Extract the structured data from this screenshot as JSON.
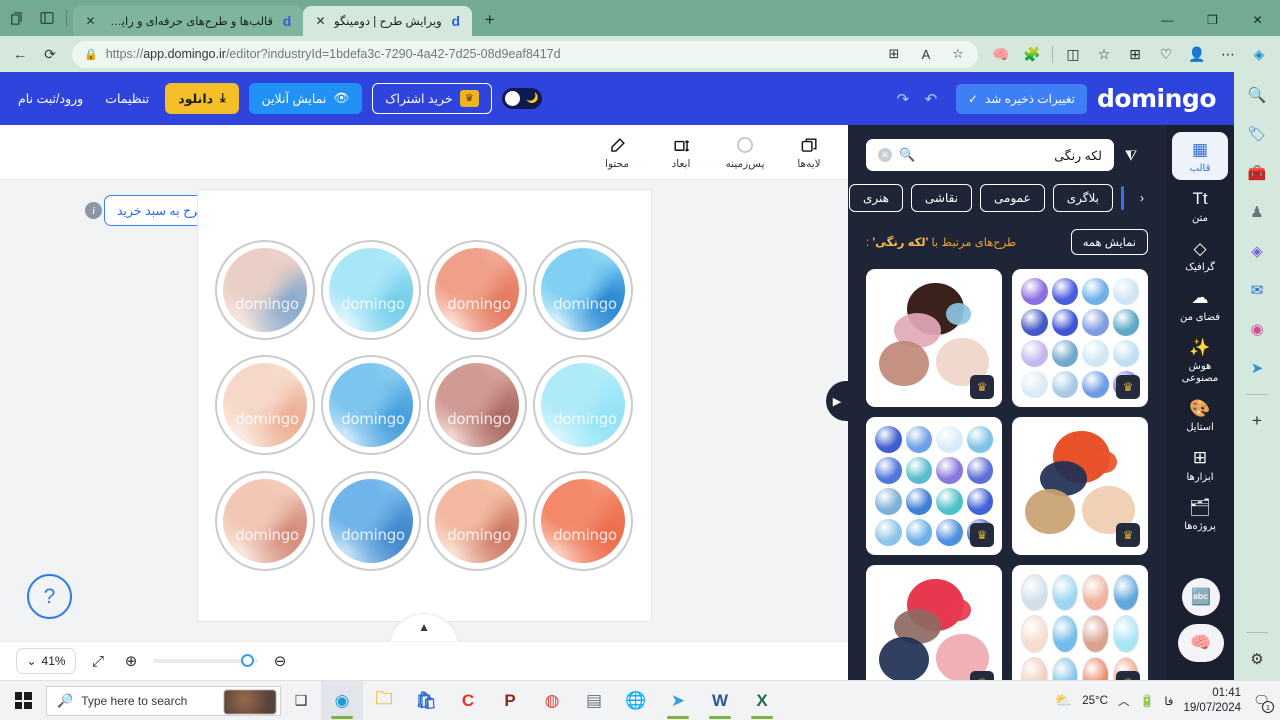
{
  "browser": {
    "tabs": [
      {
        "title": "قالب‌ها و طرح‌های حرفه‌ای و رایگان",
        "favicon": "d",
        "active": false
      },
      {
        "title": "ویرایش طرح | دومینگو",
        "favicon": "d",
        "active": true
      }
    ],
    "newtab_label": "+",
    "url_prefix": "https://",
    "url_main": "app.domingo.ir",
    "url_rest": "/editor?industryId=1bdefa3c-7290-4a42-7d25-08d9eaf8417d",
    "window_controls": {
      "minimize": "—",
      "maximize": "❐",
      "close": "✕"
    },
    "nav": {
      "back": "←",
      "reload": "⟳"
    },
    "toolbar_icons": [
      "copilot-brain-icon",
      "extensions-icon",
      "split-screen-icon",
      "favorites-icon",
      "collections-icon",
      "browser-essentials-icon",
      "profile-avatar",
      "more-options-icon",
      "copilot-icon"
    ]
  },
  "edge_sidebar": {
    "items": [
      {
        "name": "search-icon",
        "glyph": "🔍"
      },
      {
        "name": "shopping-tag-icon",
        "glyph": "🏷"
      },
      {
        "name": "tools-briefcase-icon",
        "glyph": "🧰"
      },
      {
        "name": "games-icon",
        "glyph": "♟"
      },
      {
        "name": "microsoft-365-icon",
        "glyph": "◈"
      },
      {
        "name": "outlook-icon",
        "glyph": "✉"
      },
      {
        "name": "designer-icon",
        "glyph": "◉"
      },
      {
        "name": "telegram-icon",
        "glyph": "➤"
      },
      {
        "name": "add-sidebar-app-icon",
        "glyph": "+"
      },
      {
        "name": "sidebar-settings-icon",
        "glyph": "⚙"
      }
    ]
  },
  "app_header": {
    "logo": "domingo",
    "saved_label": "تغییرات ذخیره شد",
    "saved_check": "✓",
    "undo": "↶",
    "redo": "↷",
    "dark_mode_label": "dark-mode-toggle",
    "subscription_label": "خرید اشتراک",
    "subscription_crown": "♛",
    "preview_label": "نمایش آنلاین",
    "preview_icon": "👁",
    "download_label": "دانلود",
    "download_icon": "⤓",
    "settings_label": "تنظیمات",
    "login_label": "ورود/ثبت نام"
  },
  "editor_toolbar": {
    "items": [
      {
        "label": "لایه‌ها",
        "icon": "layers-icon",
        "glyph": "❐"
      },
      {
        "label": "پس‌زمینه",
        "icon": "background-circle-icon",
        "glyph": "◯"
      },
      {
        "label": "ابعاد",
        "icon": "dimensions-icon",
        "glyph": "⤢"
      },
      {
        "label": "محتوا",
        "icon": "content-pencil-icon",
        "glyph": "✎"
      }
    ]
  },
  "canvas": {
    "add_to_cart_label": "افزودن طرح به سبد خرید",
    "cart_icon": "🛍",
    "info_icon": "i",
    "help_icon": "?",
    "bottom_handle_icon": "▲",
    "watermark": "domingo",
    "artwork_title": "grid-of-ink-circles",
    "blobs": [
      {
        "c1": "#7fd0f3",
        "c2": "#1f7fd0",
        "c3": "#d9f2fc"
      },
      {
        "c1": "#f0a089",
        "c2": "#e3745a",
        "c3": "#fae3da"
      },
      {
        "c1": "#a8e6f8",
        "c2": "#6fcbe8",
        "c3": "#e6f8fd"
      },
      {
        "c1": "#e9cfc6",
        "c2": "#7ba6cf",
        "c3": "#f7eae4"
      },
      {
        "c1": "#aeeaf8",
        "c2": "#8fe2f6",
        "c3": "#ddf7fd"
      },
      {
        "c1": "#d19a94",
        "c2": "#a5635d",
        "c3": "#f3ded6"
      },
      {
        "c1": "#7cc5ef",
        "c2": "#3f9ada",
        "c3": "#d5ecfa"
      },
      {
        "c1": "#f6d8c8",
        "c2": "#eca98f",
        "c3": "#fbeee6"
      },
      {
        "c1": "#f4886a",
        "c2": "#ec6a49",
        "c3": "#fbd8cb"
      },
      {
        "c1": "#f3b9a0",
        "c2": "#c9705a",
        "c3": "#fae6db"
      },
      {
        "c1": "#6fb4ea",
        "c2": "#3b82c9",
        "c3": "#cfe6f7"
      },
      {
        "c1": "#f2c7b6",
        "c2": "#cf8574",
        "c3": "#fbeae2"
      }
    ]
  },
  "zoom_bar": {
    "level": "41%",
    "chevron": "⌄",
    "fit_icon": "⤢",
    "zoom_in_icon": "⊕",
    "zoom_out_icon": "⊖"
  },
  "panel": {
    "collapse_icon": "▶",
    "filter_icon": "⧩",
    "search_icon": "🔍",
    "search_value": "لکه رنگی",
    "search_clear": "✕",
    "chips": [
      "هنری",
      "نقاشی",
      "عمومی",
      "بلاگری"
    ],
    "chips_prev_arrow": "‹",
    "related_title_prefix": "طرح‌های مرتبط با",
    "related_query": "'لکه رنگی'",
    "related_title_suffix": ":",
    "show_all_label": "نمایش همه",
    "crown_icon": "♛",
    "thumbnails": [
      {
        "name": "blue-purple-swatch-grid",
        "type": "grid",
        "colors": [
          "#cfe4f5",
          "#6fb0e8",
          "#4a5ddc",
          "#8b6fe0",
          "#5fa9c8",
          "#7f9de0",
          "#3f55d6",
          "#4658c6",
          "#bfe0f3",
          "#cfe8f4",
          "#6fa8cd",
          "#c3b9ef",
          "#8470e8",
          "#6f9ce6",
          "#a8c9e4",
          "#dcebf6"
        ]
      },
      {
        "name": "brown-pink-ink-cluster",
        "type": "cluster",
        "colors": [
          "#3b211c",
          "#e3a9b8",
          "#c08877",
          "#efd6c8",
          "#8ec4e0"
        ]
      },
      {
        "name": "orange-navy-ink-cluster",
        "type": "cluster",
        "colors": [
          "#e8522a",
          "#1f2f52",
          "#c9a172",
          "#f0cdb0",
          "#e8522a"
        ]
      },
      {
        "name": "blue-watercolor-swatch-grid",
        "type": "grid",
        "colors": [
          "#7fc4e8",
          "#d8ecf7",
          "#6fa0e8",
          "#3f5fd0",
          "#5f6fd8",
          "#8878e0",
          "#59bccc",
          "#4f78dd",
          "#3f62d6",
          "#4fc0c8",
          "#3f7fd8",
          "#7fb0d8",
          "#3f5fd8",
          "#4f8fe0",
          "#6fb0e8",
          "#8fc4ea"
        ]
      },
      {
        "name": "ink-circles-swatch-grid",
        "type": "gridr",
        "colors": [
          "#5fa8de",
          "#f0b49e",
          "#9fd6ef",
          "#cfe0ea",
          "#a8e6f6",
          "#dba291",
          "#6fbde8",
          "#f6ddcd",
          "#f3a183",
          "#ea8a6d",
          "#7fc2e8",
          "#f2cdbc"
        ]
      },
      {
        "name": "red-pink-ink-cluster",
        "type": "cluster",
        "colors": [
          "#e8384f",
          "#8d6a62",
          "#1f2f52",
          "#f0a8b0",
          "#e8384f"
        ]
      }
    ]
  },
  "app_rail": {
    "items": [
      {
        "label": "قالب",
        "icon": "template-grid-icon",
        "glyph": "▦",
        "active": true
      },
      {
        "label": "متن",
        "icon": "text-icon",
        "glyph": "Tt",
        "active": false
      },
      {
        "label": "گرافیک",
        "icon": "graphics-shapes-icon",
        "glyph": "◇",
        "active": false
      },
      {
        "label": "فضای من",
        "icon": "upload-cloud-icon",
        "glyph": "☁",
        "active": false
      },
      {
        "label": "هوش مصنوعی",
        "icon": "ai-wand-icon",
        "glyph": "✨",
        "active": false
      },
      {
        "label": "استایل",
        "icon": "palette-icon",
        "glyph": "🎨",
        "active": false
      },
      {
        "label": "ابزارها",
        "icon": "tools-grid-icon",
        "glyph": "⊞",
        "active": false
      },
      {
        "label": "پروژه‌ها",
        "icon": "projects-icon",
        "glyph": "🗂",
        "active": false
      }
    ],
    "floating_translate_icon": "🔤",
    "floating_ai_icon": "🧠"
  },
  "taskbar": {
    "search_placeholder": "Type here to search",
    "search_icon": "🔎",
    "task_view_icon": "❑",
    "apps": [
      {
        "name": "edge-icon",
        "glyph": "◉",
        "color": "#1a9bd7",
        "active": true,
        "running": true
      },
      {
        "name": "file-explorer-icon",
        "glyph": "🗀",
        "color": "#f5c04a",
        "active": false,
        "running": false
      },
      {
        "name": "microsoft-store-icon",
        "glyph": "🛍",
        "color": "#2f6fd0",
        "active": false,
        "running": false
      },
      {
        "name": "camtasia-icon",
        "glyph": "C",
        "color": "#e8342a",
        "active": false,
        "running": false
      },
      {
        "name": "photoscape-icon",
        "glyph": "P",
        "color": "#8a2b1f",
        "active": false,
        "running": false
      },
      {
        "name": "chrome-icon",
        "glyph": "◍",
        "color": "#e8453c",
        "active": false,
        "running": false
      },
      {
        "name": "notes-app-icon",
        "glyph": "▤",
        "color": "#6b7280",
        "active": false,
        "running": false
      },
      {
        "name": "idm-icon",
        "glyph": "🌐",
        "color": "#2f8f3f",
        "active": false,
        "running": false
      },
      {
        "name": "telegram-icon",
        "glyph": "➤",
        "color": "#2f9fdf",
        "active": false,
        "running": true
      },
      {
        "name": "word-icon",
        "glyph": "W",
        "color": "#2b5797",
        "active": false,
        "running": true
      },
      {
        "name": "excel-icon",
        "glyph": "X",
        "color": "#1d6f42",
        "active": false,
        "running": true
      }
    ],
    "weather_temp": "25°C",
    "weather_icon": "⛅",
    "chevron_up": "︿",
    "battery_icon": "🔋",
    "language": "فا",
    "time": "01:41",
    "date": "19/07/2024",
    "notification_icon": "🗨",
    "notification_count": "1"
  },
  "colors": {
    "brand_blue": "#2f44dd",
    "panel_dark": "#1e2536",
    "rail_dark": "#1a2030",
    "accent_yellow": "#f5bf2a",
    "accent_orange": "#f0a030",
    "browser_green": "#72ab91"
  }
}
